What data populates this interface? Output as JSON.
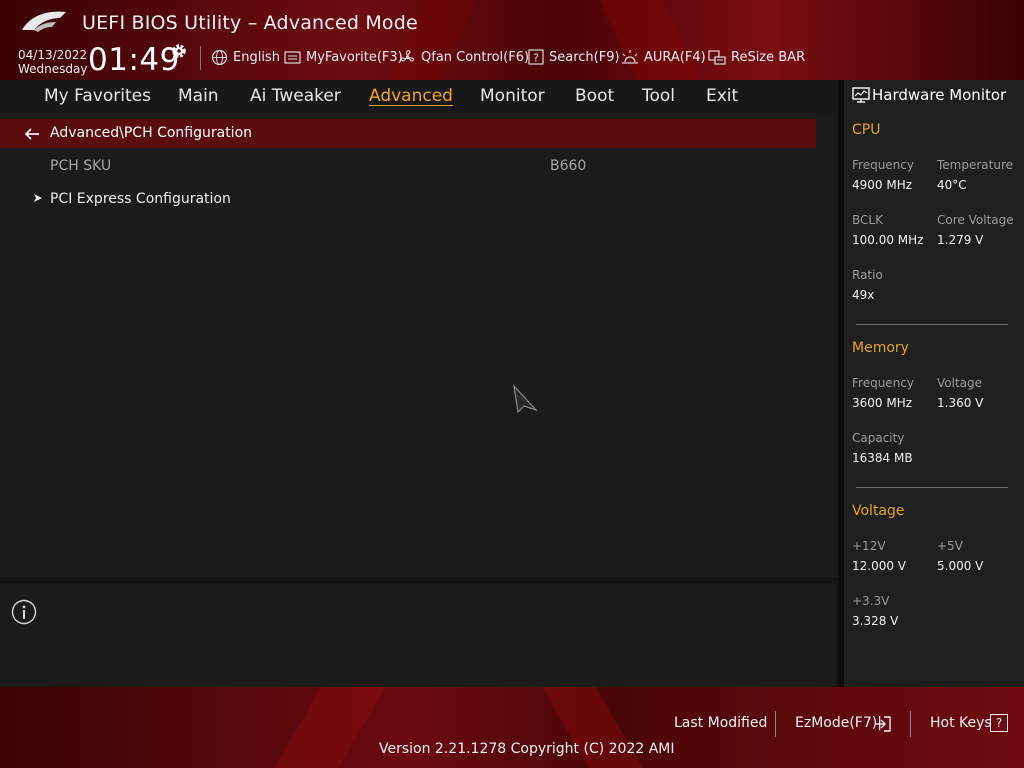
{
  "header": {
    "title": "UEFI BIOS Utility – Advanced Mode",
    "date": "04/13/2022",
    "day": "Wednesday",
    "time": "01:49",
    "toolbar": [
      {
        "label": "English",
        "icon": "globe-icon"
      },
      {
        "label": "MyFavorite(F3)",
        "icon": "favorite-list-icon"
      },
      {
        "label": "Qfan Control(F6)",
        "icon": "fan-icon"
      },
      {
        "label": "Search(F9)",
        "icon": "search-help-icon"
      },
      {
        "label": "AURA(F4)",
        "icon": "aura-light-icon"
      },
      {
        "label": "ReSize BAR",
        "icon": "resize-bar-icon"
      }
    ]
  },
  "nav": {
    "tabs": [
      "My Favorites",
      "Main",
      "Ai Tweaker",
      "Advanced",
      "Monitor",
      "Boot",
      "Tool",
      "Exit"
    ],
    "active": "Advanced"
  },
  "main": {
    "breadcrumb": "Advanced\\PCH Configuration",
    "rows": [
      {
        "label": "PCH SKU",
        "value": "B660"
      },
      {
        "label": "PCI Express Configuration"
      }
    ]
  },
  "hw_monitor": {
    "title": "Hardware Monitor",
    "cpu": {
      "heading": "CPU",
      "frequency_label": "Frequency",
      "frequency": "4900 MHz",
      "temperature_label": "Temperature",
      "temperature": "40°C",
      "bclk_label": "BCLK",
      "bclk": "100.00 MHz",
      "core_voltage_label": "Core Voltage",
      "core_voltage": "1.279 V",
      "ratio_label": "Ratio",
      "ratio": "49x"
    },
    "memory": {
      "heading": "Memory",
      "frequency_label": "Frequency",
      "frequency": "3600 MHz",
      "voltage_label": "Voltage",
      "voltage": "1.360 V",
      "capacity_label": "Capacity",
      "capacity": "16384 MB"
    },
    "voltage": {
      "heading": "Voltage",
      "v12_label": "+12V",
      "v12": "12.000 V",
      "v5_label": "+5V",
      "v5": "5.000 V",
      "v33_label": "+3.3V",
      "v33": "3.328 V"
    }
  },
  "footer": {
    "last_modified": "Last Modified",
    "ezmode": "EzMode(F7)|",
    "hotkeys": "Hot Keys",
    "hotkeys_badge": "?",
    "version": "Version 2.21.1278 Copyright (C) 2022 AMI"
  },
  "colors": {
    "accent": "#f2a41f",
    "header_red": "#6d0b10",
    "breadcrumb_bar": "#5a0c0d"
  }
}
